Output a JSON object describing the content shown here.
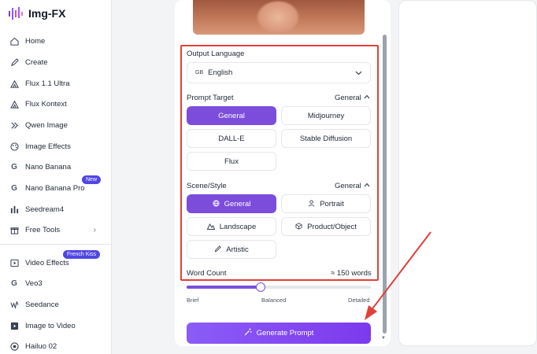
{
  "brand": {
    "title": "Img-FX",
    "accent": "#7c4ddb"
  },
  "sidebar": {
    "items": [
      {
        "label": "Home",
        "icon": "home-icon"
      },
      {
        "label": "Create",
        "icon": "pen-icon"
      },
      {
        "label": "Flux 1.1 Ultra",
        "icon": "flux-icon"
      },
      {
        "label": "Flux Kontext",
        "icon": "flux-icon"
      },
      {
        "label": "Qwen Image",
        "icon": "qwen-icon"
      },
      {
        "label": "Image Effects",
        "icon": "palette-icon"
      },
      {
        "label": "Nano Banana",
        "icon": "google-icon"
      },
      {
        "label": "Nano Banana Pro",
        "icon": "google-icon",
        "badge": "New"
      },
      {
        "label": "Seedream4",
        "icon": "bars-icon"
      },
      {
        "label": "Free Tools",
        "icon": "gift-icon"
      },
      {
        "label": "Video Effects",
        "icon": "video-icon",
        "badge": "French Kiss"
      },
      {
        "label": "Veo3",
        "icon": "google-icon"
      },
      {
        "label": "Seedance",
        "icon": "seedance-icon"
      },
      {
        "label": "Image to Video",
        "icon": "image-video-icon"
      },
      {
        "label": "Hailuo 02",
        "icon": "hailuo-icon"
      }
    ]
  },
  "form": {
    "output_language": {
      "label": "Output Language",
      "flag": "GB",
      "value": "English"
    },
    "prompt_target": {
      "label": "Prompt Target",
      "selected": "General",
      "options": [
        "General",
        "Midjourney",
        "DALL-E",
        "Stable Diffusion",
        "Flux"
      ]
    },
    "scene_style": {
      "label": "Scene/Style",
      "selected": "General",
      "options": [
        "General",
        "Portrait",
        "Landscape",
        "Product/Object",
        "Artistic"
      ]
    },
    "word_count": {
      "label": "Word Count",
      "value": "≈ 150 words",
      "ticks": [
        "Brief",
        "Balanced",
        "Detailed"
      ],
      "level": 0.4
    },
    "generate_label": "Generate Prompt"
  },
  "colors": {
    "highlight": "#e0403a",
    "active": "#7c4ddb"
  }
}
